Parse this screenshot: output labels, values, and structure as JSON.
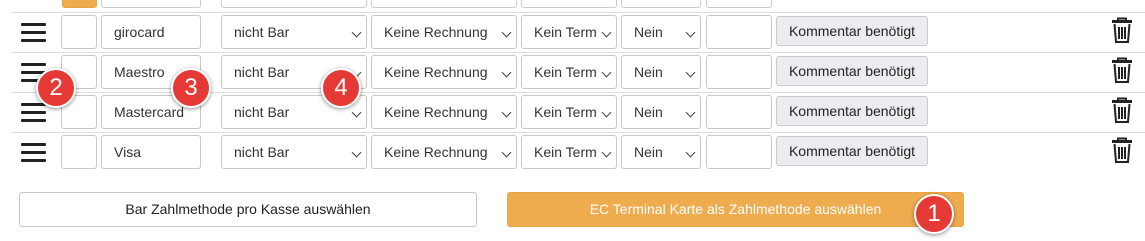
{
  "rows": [
    {
      "name": "girocard",
      "payment_type": "nicht Bar",
      "invoice": "Keine Rechnung",
      "terminal": "Kein Term",
      "yes_no": "Nein",
      "comment_button": "Kommentar benötigt"
    },
    {
      "name": "Maestro",
      "payment_type": "nicht Bar",
      "invoice": "Keine Rechnung",
      "terminal": "Kein Term",
      "yes_no": "Nein",
      "comment_button": "Kommentar benötigt"
    },
    {
      "name": "Mastercard",
      "payment_type": "nicht Bar",
      "invoice": "Keine Rechnung",
      "terminal": "Kein Term",
      "yes_no": "Nein",
      "comment_button": "Kommentar benötigt"
    },
    {
      "name": "Visa",
      "payment_type": "nicht Bar",
      "invoice": "Keine Rechnung",
      "terminal": "Kein Term",
      "yes_no": "Nein",
      "comment_button": "Kommentar benötigt"
    }
  ],
  "buttons": {
    "select_cash": "Bar Zahlmethode pro Kasse auswählen",
    "select_ec": "EC Terminal Karte als Zahlmethode auswählen"
  },
  "markers": [
    "1",
    "2",
    "3",
    "4"
  ],
  "icons": {
    "drag": "drag-handle-icon",
    "delete": "trash-icon",
    "dropdown": "chevron-down-icon"
  },
  "colors": {
    "accent": "#efac4f",
    "marker": "#e53935",
    "comment_button_bg": "#ececf0"
  }
}
